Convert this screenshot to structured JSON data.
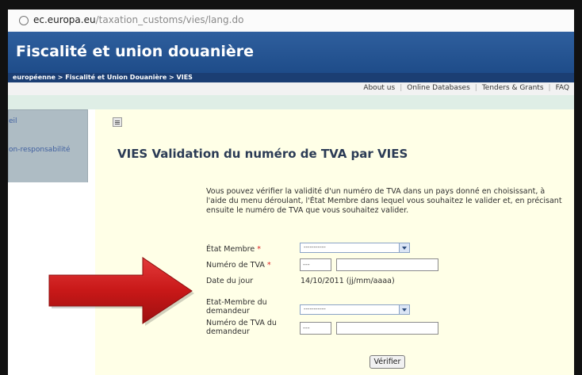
{
  "browser": {
    "url_host": "ec.europa.eu",
    "url_path": "/taxation_customs/vies/lang.do"
  },
  "header": {
    "title": "Fiscalité et union douanière",
    "breadcrumb": "européenne > Fiscalité et Union Douanière > VIES"
  },
  "topnav": {
    "items": [
      "About us",
      "Online Databases",
      "Tenders & Grants",
      "FAQ"
    ]
  },
  "sidebar": {
    "items": [
      "eil",
      "on-responsabilité"
    ]
  },
  "main": {
    "title": "VIES Validation du numéro de TVA par VIES",
    "intro": "Vous pouvez vérifier la validité d'un numéro de TVA dans un pays donné en choisissant, à l'aide du menu déroulant, l'État Membre dans lequel vous souhaitez le valider et, en précisant ensuite le numéro de TVA que vous souhaitez valider."
  },
  "form": {
    "member_state_label": "État Membre",
    "member_state_value": "-----------",
    "vat_label": "Numéro de TVA",
    "vat_prefix": "---",
    "vat_value": "",
    "date_label": "Date du jour",
    "date_value": "14/10/2011 (jj/mm/aaaa)",
    "requester_state_label_1": "Etat-Membre du",
    "requester_state_label_2": "demandeur",
    "requester_state_value": "-----------",
    "requester_vat_label_1": "Numéro de TVA du",
    "requester_vat_label_2": "demandeur",
    "requester_vat_prefix": "---",
    "requester_vat_value": "",
    "required_mark": "*",
    "submit_label": "Vérifier"
  },
  "colors": {
    "banner": "#1e4c89",
    "breadcrumb_bar": "#1b3e73",
    "content_bg": "#ffffe7",
    "sidebar_bg": "#aebcc4",
    "arrow": "#c81818"
  },
  "icons": [
    "site-info-icon",
    "page-menu-icon",
    "dropdown-arrow-icon",
    "annotation-arrow"
  ]
}
